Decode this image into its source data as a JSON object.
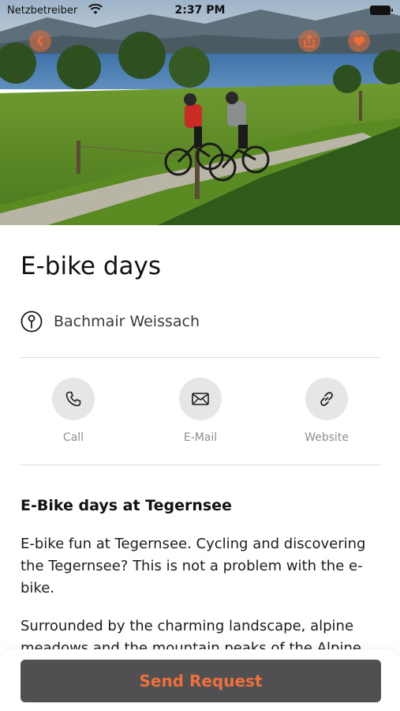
{
  "status_bar": {
    "carrier": "Netzbetreiber",
    "time": "2:37 PM"
  },
  "hero": {
    "image_description_icon": "photo-cyclists-lake"
  },
  "event": {
    "title": "E-bike days",
    "location": "Bachmair Weissach"
  },
  "actions": [
    {
      "label": "Call",
      "icon": "phone-icon"
    },
    {
      "label": "E-Mail",
      "icon": "mail-icon"
    },
    {
      "label": "Website",
      "icon": "link-icon"
    }
  ],
  "description": {
    "heading": "E-Bike days at Tegernsee",
    "paragraph1": "E-bike fun at Tegernsee. Cycling and discovering the Tegernsee? This is not a problem with the e-bike.",
    "paragraph2": "Surrounded by the charming landscape, alpine meadows and the mountain peaks of the Alpine"
  },
  "footer": {
    "send_label": "Send Request"
  },
  "colors": {
    "accent": "#f0703c",
    "button_bg": "#505052"
  }
}
